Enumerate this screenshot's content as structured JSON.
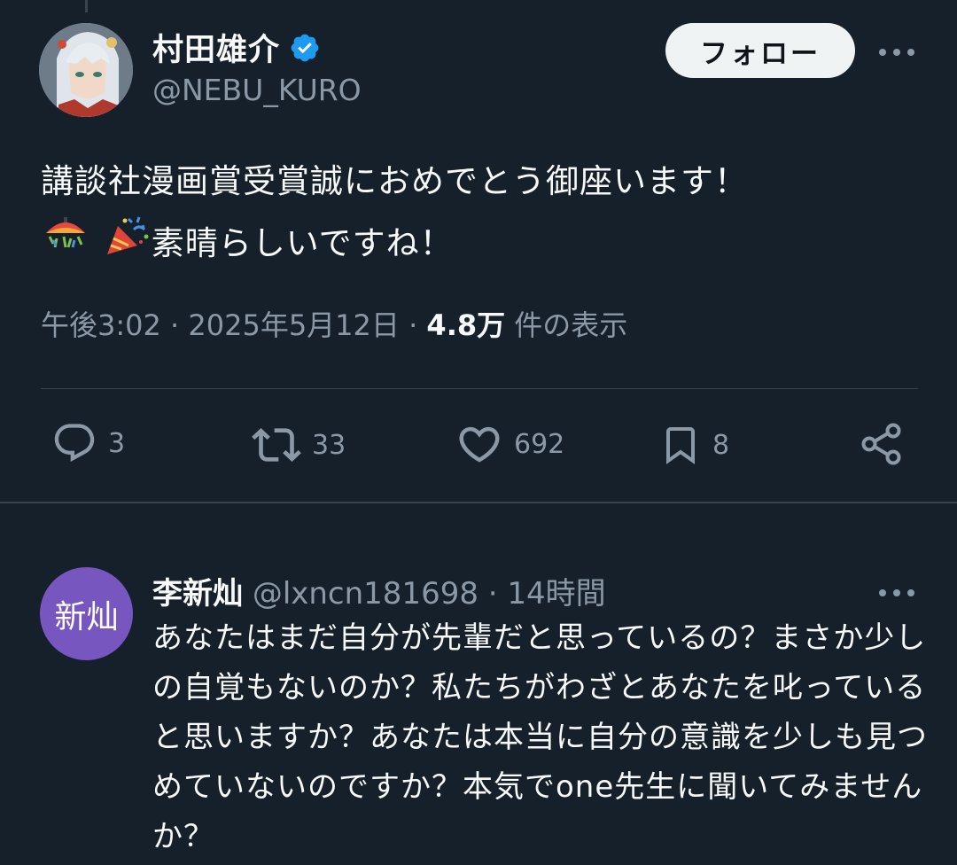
{
  "tweet": {
    "author": {
      "name": "村田雄介",
      "handle": "@NEBU_KURO"
    },
    "follow_label": "フォロー",
    "text_line1": "講談社漫画賞受賞誠におめでとう御座います！",
    "text_line2": "素晴らしいですね！",
    "timestamp": "午後3:02 · 2025年5月12日 · ",
    "views": "4.8万",
    "views_suffix": " 件の表示",
    "stats": {
      "replies": "3",
      "retweets": "33",
      "likes": "692",
      "bookmarks": "8"
    }
  },
  "reply": {
    "avatar_text": "新灿",
    "name": "李新灿",
    "handle": "@lxncn181698 · 14時間",
    "text": "あなたはまだ自分が先輩だと思っているの？まさか少しの自覚もないのか？私たちがわざとあなたを叱っていると思いますか？あなたは本当に自分の意識を少しも見つめていないのですか？本気でone先生に聞いてみませんか？"
  },
  "colors": {
    "background": "#15202b",
    "text": "#f7f9f9",
    "muted": "#8b98a5",
    "verified": "#1d9bf0",
    "divider": "#38444d",
    "reply_avatar": "#7856c0"
  },
  "icons": [
    "verified-badge-icon",
    "more-icon",
    "reply-icon",
    "retweet-icon",
    "like-icon",
    "bookmark-icon",
    "share-icon",
    "confetti-ball-icon",
    "party-popper-icon"
  ]
}
